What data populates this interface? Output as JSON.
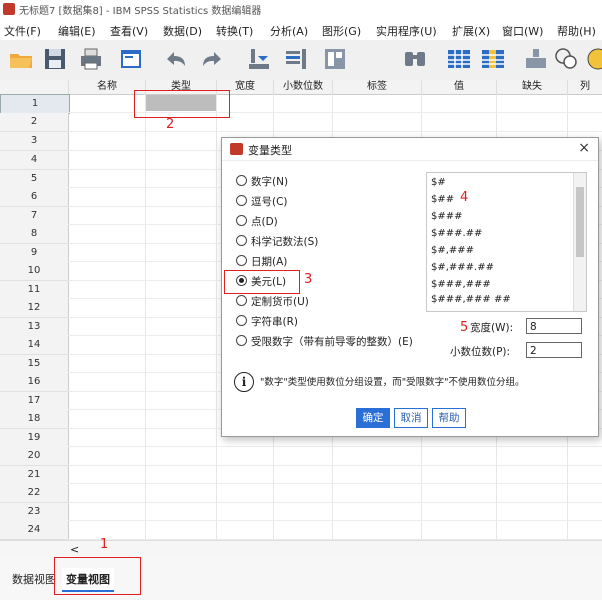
{
  "window": {
    "title": "无标题7 [数据集8] - IBM SPSS Statistics 数据编辑器"
  },
  "menu": [
    "文件(F)",
    "编辑(E)",
    "查看(V)",
    "数据(D)",
    "转换(T)",
    "分析(A)",
    "图形(G)",
    "实用程序(U)",
    "扩展(X)",
    "窗口(W)",
    "帮助(H)"
  ],
  "toolbar_icons": [
    "open-folder-icon",
    "save-icon",
    "print-icon",
    "dialog-recall-icon",
    "undo-icon",
    "redo-icon",
    "goto-case-icon",
    "goto-variable-icon",
    "variables-icon",
    "find-icon",
    "insert-cases-icon",
    "insert-variable-icon",
    "split-file-icon",
    "weight-cases-icon",
    "select-cases-icon"
  ],
  "grid": {
    "columns": [
      "名称",
      "类型",
      "宽度",
      "小数位数",
      "标签",
      "值",
      "缺失",
      "列"
    ],
    "rows": [
      "1",
      "2",
      "3",
      "4",
      "5",
      "6",
      "7",
      "8",
      "9",
      "10",
      "11",
      "12",
      "13",
      "14",
      "15",
      "16",
      "17",
      "18",
      "19",
      "20",
      "21",
      "22",
      "23",
      "24"
    ]
  },
  "annotations": {
    "n1": "1",
    "n2": "2",
    "n3": "3",
    "n4": "4",
    "n5": "5"
  },
  "tabs": {
    "data_view": "数据视图",
    "variable_view": "变量视图"
  },
  "scroll_left": "<",
  "dialog": {
    "title": "变量类型",
    "close": "×",
    "options": [
      "数字(N)",
      "逗号(C)",
      "点(D)",
      "科学记数法(S)",
      "日期(A)",
      "美元(L)",
      "定制货币(U)",
      "字符串(R)",
      "受限数字（带有前导零的整数）(E)"
    ],
    "selected": "美元(L)",
    "formats": [
      "$#",
      "$##",
      "$###",
      "$###.##",
      "$#,###",
      "$#,###.##",
      "$###,###",
      "$###,### ##"
    ],
    "width_label": "宽度(W):",
    "width_value": "8",
    "decimals_label": "小数位数(P):",
    "decimals_value": "2",
    "info_text": "\"数字\"类型使用数位分组设置，而\"受限数字\"不使用数位分组。",
    "ok": "确定",
    "cancel": "取消",
    "help": "帮助"
  }
}
